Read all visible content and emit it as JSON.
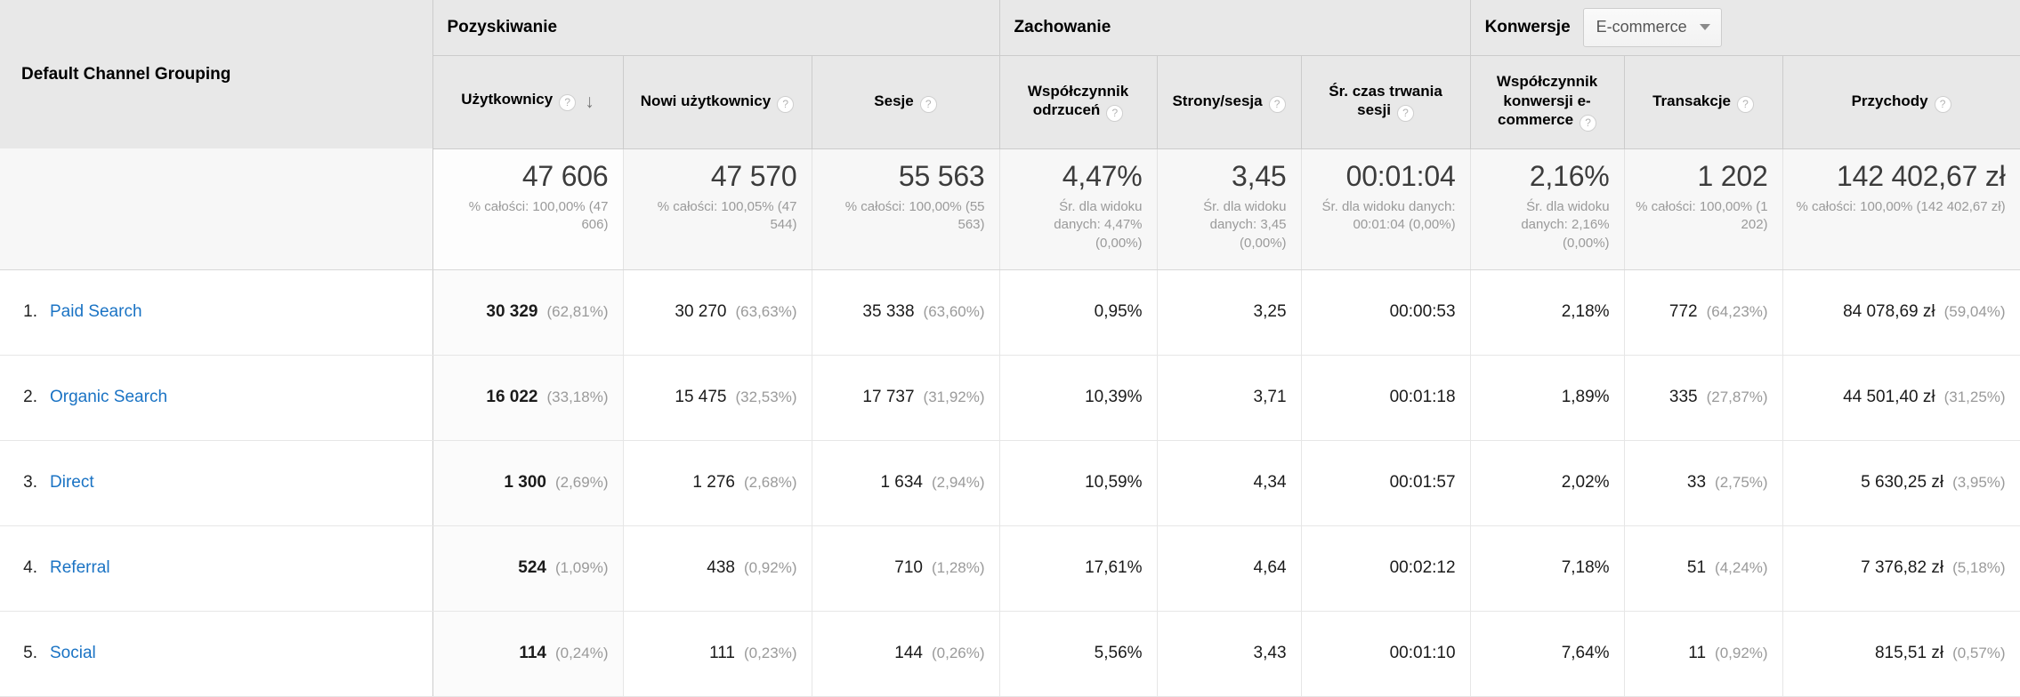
{
  "groups": {
    "dimension_label": "Default Channel Grouping",
    "acquisition": "Pozyskiwanie",
    "behavior": "Zachowanie",
    "conversions": "Konwersje",
    "conversion_selector_value": "E-commerce"
  },
  "metrics": [
    {
      "label": "Użytkownicy",
      "help": "?",
      "sorted": true,
      "sort_dir": "↓"
    },
    {
      "label": "Nowi użytkownicy",
      "help": "?",
      "sorted": false
    },
    {
      "label": "Sesje",
      "help": "?",
      "sorted": false
    },
    {
      "label": "Współczynnik odrzuceń",
      "help": "?",
      "sorted": false
    },
    {
      "label": "Strony/sesja",
      "help": "?",
      "sorted": false
    },
    {
      "label": "Śr. czas trwania sesji",
      "help": "?",
      "sorted": false
    },
    {
      "label": "Współczynnik konwersji e-commerce",
      "help": "?",
      "sorted": false
    },
    {
      "label": "Transakcje",
      "help": "?",
      "sorted": false
    },
    {
      "label": "Przychody",
      "help": "?",
      "sorted": false
    }
  ],
  "summary": [
    {
      "big": "47 606",
      "sub": "% całości: 100,00% (47 606)"
    },
    {
      "big": "47 570",
      "sub": "% całości: 100,05% (47 544)"
    },
    {
      "big": "55 563",
      "sub": "% całości: 100,00% (55 563)"
    },
    {
      "big": "4,47%",
      "sub": "Śr. dla widoku danych: 4,47% (0,00%)"
    },
    {
      "big": "3,45",
      "sub": "Śr. dla widoku danych: 3,45 (0,00%)"
    },
    {
      "big": "00:01:04",
      "sub": "Śr. dla widoku danych: 00:01:04 (0,00%)"
    },
    {
      "big": "2,16%",
      "sub": "Śr. dla widoku danych: 2,16% (0,00%)"
    },
    {
      "big": "1 202",
      "sub": "% całości: 100,00% (1 202)"
    },
    {
      "big": "142 402,67 zł",
      "sub": "% całości: 100,00% (142 402,67 zł)"
    }
  ],
  "rows": [
    {
      "index": "1.",
      "channel": "Paid Search",
      "users": "30 329",
      "users_pct": "(62,81%)",
      "new_users": "30 270",
      "new_users_pct": "(63,63%)",
      "sessions": "35 338",
      "sessions_pct": "(63,60%)",
      "bounce": "0,95%",
      "pages": "3,25",
      "avg_time": "00:00:53",
      "conv_rate": "2,18%",
      "transactions": "772",
      "transactions_pct": "(64,23%)",
      "revenue": "84 078,69 zł",
      "revenue_pct": "(59,04%)"
    },
    {
      "index": "2.",
      "channel": "Organic Search",
      "users": "16 022",
      "users_pct": "(33,18%)",
      "new_users": "15 475",
      "new_users_pct": "(32,53%)",
      "sessions": "17 737",
      "sessions_pct": "(31,92%)",
      "bounce": "10,39%",
      "pages": "3,71",
      "avg_time": "00:01:18",
      "conv_rate": "1,89%",
      "transactions": "335",
      "transactions_pct": "(27,87%)",
      "revenue": "44 501,40 zł",
      "revenue_pct": "(31,25%)"
    },
    {
      "index": "3.",
      "channel": "Direct",
      "users": "1 300",
      "users_pct": "(2,69%)",
      "new_users": "1 276",
      "new_users_pct": "(2,68%)",
      "sessions": "1 634",
      "sessions_pct": "(2,94%)",
      "bounce": "10,59%",
      "pages": "4,34",
      "avg_time": "00:01:57",
      "conv_rate": "2,02%",
      "transactions": "33",
      "transactions_pct": "(2,75%)",
      "revenue": "5 630,25 zł",
      "revenue_pct": "(3,95%)"
    },
    {
      "index": "4.",
      "channel": "Referral",
      "users": "524",
      "users_pct": "(1,09%)",
      "new_users": "438",
      "new_users_pct": "(0,92%)",
      "sessions": "710",
      "sessions_pct": "(1,28%)",
      "bounce": "17,61%",
      "pages": "4,64",
      "avg_time": "00:02:12",
      "conv_rate": "7,18%",
      "transactions": "51",
      "transactions_pct": "(4,24%)",
      "revenue": "7 376,82 zł",
      "revenue_pct": "(5,18%)"
    },
    {
      "index": "5.",
      "channel": "Social",
      "users": "114",
      "users_pct": "(0,24%)",
      "new_users": "111",
      "new_users_pct": "(0,23%)",
      "sessions": "144",
      "sessions_pct": "(0,26%)",
      "bounce": "5,56%",
      "pages": "3,43",
      "avg_time": "00:01:10",
      "conv_rate": "7,64%",
      "transactions": "11",
      "transactions_pct": "(0,92%)",
      "revenue": "815,51 zł",
      "revenue_pct": "(0,57%)"
    }
  ],
  "colors": {
    "link": "#1a73c4",
    "header_bg": "#e8e8e8",
    "summary_bg": "#f7f7f7",
    "muted_text": "#9a9a9a"
  }
}
